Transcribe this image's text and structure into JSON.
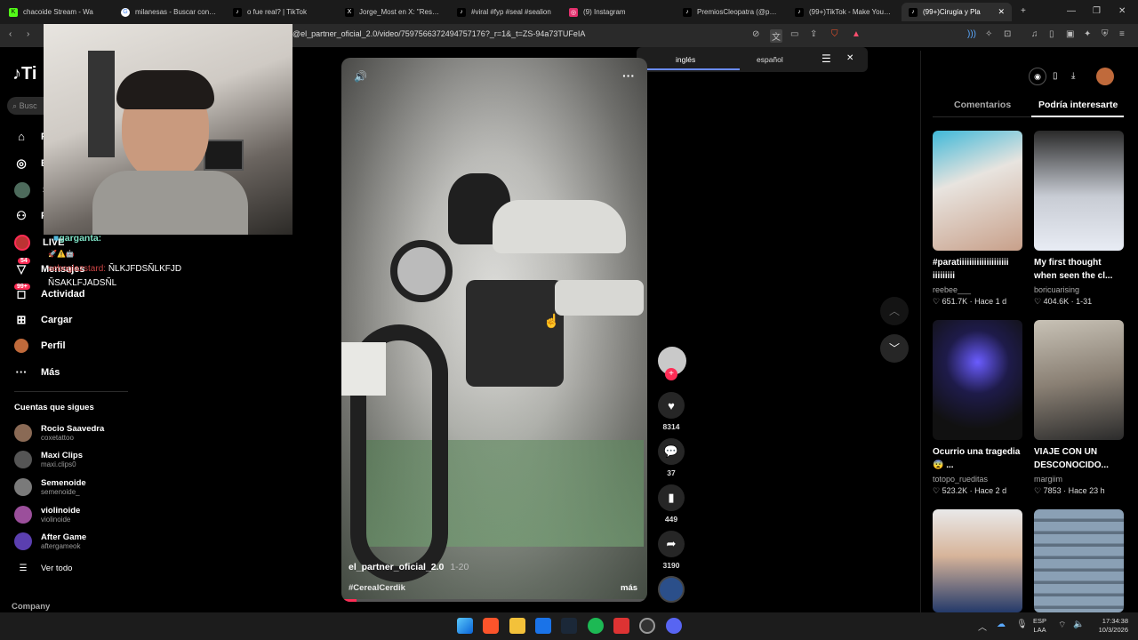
{
  "browser": {
    "tabs": [
      {
        "label": "chacoide Stream - Wa",
        "icon": "kick-icon",
        "color": "#53fc18"
      },
      {
        "label": "milanesas - Buscar con Go",
        "icon": "google-icon",
        "color": "#ffffff"
      },
      {
        "label": "o fue real? | TikTok",
        "icon": "tiktok-icon",
        "color": "#ffffff"
      },
      {
        "label": "Jorge_Most en X: \"Resume",
        "icon": "x-icon",
        "color": "#ffffff"
      },
      {
        "label": "#viral #fyp #seal #sealion",
        "icon": "tiktok-icon",
        "color": "#ffffff"
      },
      {
        "label": "(9) Instagram",
        "icon": "instagram-icon",
        "color": "#e1306c"
      },
      {
        "label": "PremiosCleopatra (@prem",
        "icon": "tiktok-icon",
        "color": "#ffffff"
      },
      {
        "label": "(99+)TikTok - Make Your D",
        "icon": "tiktok-icon",
        "color": "#ffffff"
      },
      {
        "label": "(99+)Cirugía y Pla",
        "icon": "tiktok-icon",
        "color": "#ffffff"
      }
    ],
    "url": "@el_partner_oficial_2.0/video/7597566372494757176?_r=1&_t=ZS-94a73TUFeIA"
  },
  "translate_popup": {
    "lang_from": "inglés",
    "lang_to": "español"
  },
  "sidebar": {
    "logo": "Ti",
    "search_placeholder": "Busc",
    "nav": [
      {
        "label": "P",
        "icon": "home-icon"
      },
      {
        "label": "E",
        "icon": "compass-icon"
      },
      {
        "label": "S",
        "icon": "avatar-icon"
      },
      {
        "label": "F",
        "icon": "people-icon"
      },
      {
        "label": "LIVE",
        "icon": "live-icon"
      },
      {
        "label": "Mensajes",
        "icon": "messages-icon",
        "badge": "54"
      },
      {
        "label": "Actividad",
        "icon": "activity-icon",
        "badge": "99+"
      },
      {
        "label": "Cargar",
        "icon": "upload-icon"
      },
      {
        "label": "Perfil",
        "icon": "profile-icon"
      },
      {
        "label": "Más",
        "icon": "more-icon"
      }
    ],
    "following_title": "Cuentas que sigues",
    "following": [
      {
        "name": "Rocio Saavedra",
        "handle": "coxetattoo",
        "color": "#8a6a55"
      },
      {
        "name": "Maxi Clips",
        "handle": "maxi.clips0",
        "color": "#555555"
      },
      {
        "name": "Semenoide",
        "handle": "semenoide_",
        "color": "#7a7a7a"
      },
      {
        "name": "violinoide",
        "handle": "violinoide",
        "color": "#9b4f9b"
      },
      {
        "name": "After Game",
        "handle": "aftergameok",
        "color": "#5b3fb0"
      }
    ],
    "see_all": "Ver todo",
    "company": "Company"
  },
  "chat_overlay": {
    "line1_user": "garganta:",
    "line2_user": "seboglazstard:",
    "line2_text": "ÑLKJFDSÑLKFJD",
    "line3_text": "ÑSAKLFJADSÑL"
  },
  "video": {
    "author": "el_partner_oficial_2.0",
    "date": "1-20",
    "hashtag": "#CerealCerdik",
    "more": "más",
    "progress": 0.05
  },
  "actions": {
    "likes": "8314",
    "comments": "37",
    "saves": "449",
    "shares": "3190"
  },
  "right_panel": {
    "tab_comments": "Comentarios",
    "tab_suggested": "Podría interesarte",
    "cards": [
      {
        "title": "#paratiiiiiiiiiiiiiiiiiiii iiiiiiiii",
        "author": "reebee___",
        "likes": "651.7K",
        "time": "Hace 1 d",
        "color": "#c9b39f"
      },
      {
        "title": "My first thought when seen the cl...",
        "author": "boricuarising",
        "likes": "404.6K",
        "time": "1-31",
        "color": "#8e9aa8"
      },
      {
        "title": "Ocurrio una tragedia😨 ...",
        "author": "totopo_rueditas",
        "likes": "523.2K",
        "time": "Hace 2 d",
        "color": "#1d1d3a"
      },
      {
        "title": "VIAJE CON UN DESCONOCIDO...",
        "author": "margiim",
        "likes": "7853",
        "time": "Hace 23 h",
        "color": "#7d7264"
      },
      {
        "title": "",
        "author": "",
        "likes": "",
        "time": "",
        "color": "#3b5a86"
      },
      {
        "title": "",
        "author": "",
        "likes": "",
        "time": "",
        "color": "#8aa0b5"
      }
    ]
  },
  "taskbar": {
    "lang": "ESP",
    "lang2": "LAA",
    "time": "17:34:38",
    "date": "10/3/2026"
  }
}
